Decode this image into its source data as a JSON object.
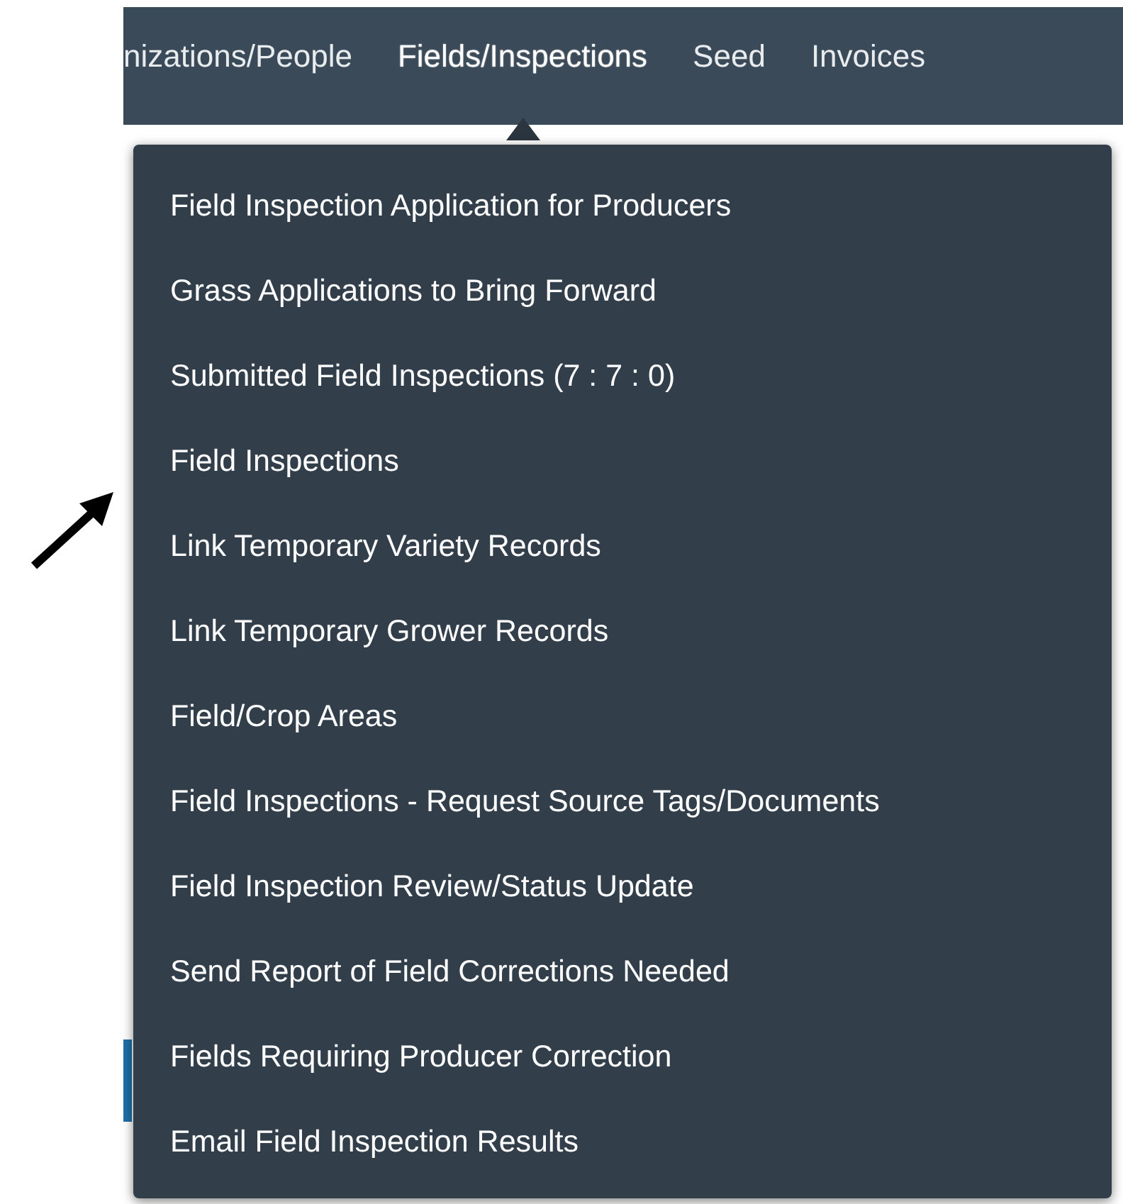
{
  "nav": {
    "items": [
      {
        "label": "nizations/People",
        "selected": false
      },
      {
        "label": "Fields/Inspections",
        "selected": true
      },
      {
        "label": "Seed",
        "selected": false
      },
      {
        "label": "Invoices",
        "selected": false
      }
    ]
  },
  "dropdown_menu": {
    "items": [
      {
        "label": "Field Inspection Application for Producers"
      },
      {
        "label": "Grass Applications to Bring Forward"
      },
      {
        "label": "Submitted Field Inspections (7 : 7 : 0)"
      },
      {
        "label": "Field Inspections"
      },
      {
        "label": "Link Temporary Variety Records"
      },
      {
        "label": "Link Temporary Grower Records"
      },
      {
        "label": "Field/Crop Areas"
      },
      {
        "label": "Field Inspections - Request Source Tags/Documents"
      },
      {
        "label": "Field Inspection Review/Status Update"
      },
      {
        "label": "Send Report of Field Corrections Needed"
      },
      {
        "label": "Fields Requiring Producer Correction"
      },
      {
        "label": "Email Field Inspection Results"
      }
    ]
  }
}
